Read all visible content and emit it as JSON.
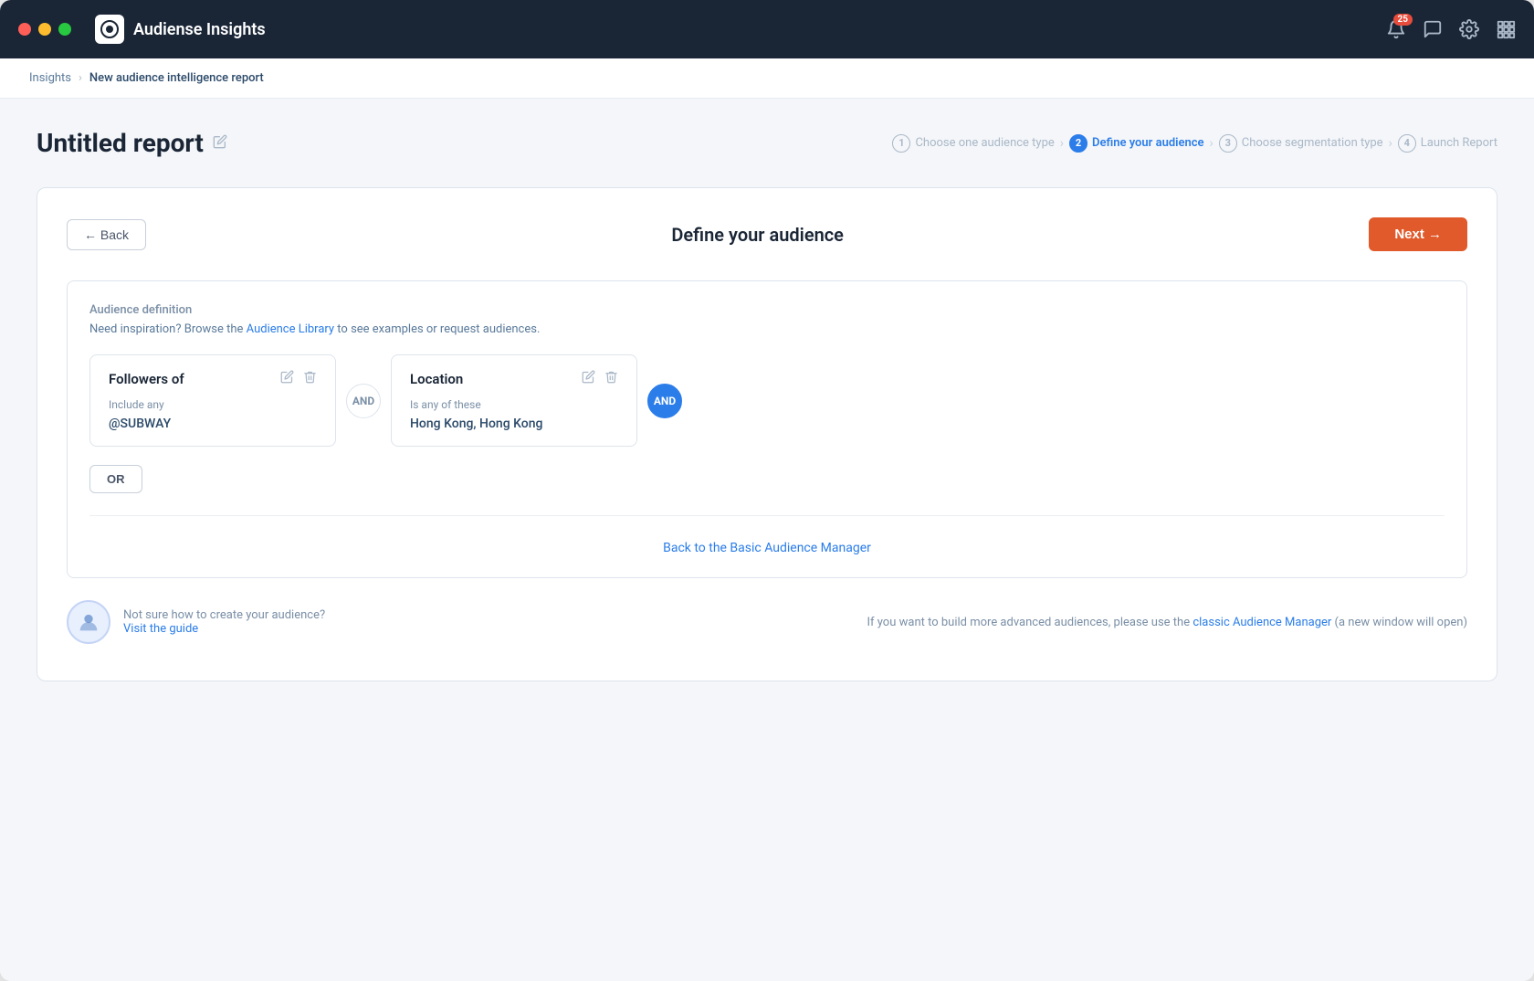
{
  "window": {
    "app_name": "Audiense Insights"
  },
  "breadcrumb": {
    "root": "Insights",
    "current": "New audience intelligence report"
  },
  "report": {
    "title": "Untitled report"
  },
  "steps": [
    {
      "num": "1",
      "label": "Choose one audience type",
      "state": "done"
    },
    {
      "num": "2",
      "label": "Define your audience",
      "state": "active"
    },
    {
      "num": "3",
      "label": "Choose segmentation type",
      "state": "upcoming"
    },
    {
      "num": "4",
      "label": "Launch Report",
      "state": "upcoming"
    }
  ],
  "toolbar": {
    "back_label": "← Back",
    "next_label": "Next →",
    "page_heading": "Define your audience"
  },
  "audience_def": {
    "label": "Audience definition",
    "description_pre": "Need inspiration? Browse the ",
    "link_text": "Audience Library",
    "description_post": " to see examples or request audiences."
  },
  "conditions": [
    {
      "id": "followers_of",
      "title": "Followers of",
      "tag": "Include any",
      "value": "@SUBWAY",
      "connector": "AND",
      "connector_type": "plain"
    },
    {
      "id": "location",
      "title": "Location",
      "tag": "Is any of these",
      "value": "Hong Kong, Hong Kong",
      "connector": "AND",
      "connector_type": "blue"
    }
  ],
  "or_button": "OR",
  "footer_link": "Back to the Basic Audience Manager",
  "help": {
    "text_pre": "Not sure how to create your audience?",
    "link_text": "Visit the guide"
  },
  "advanced": {
    "text_pre": "If you want to build more advanced audiences, please use the ",
    "link_text": "classic Audience Manager",
    "text_post": " (a new window will open)"
  },
  "nav": {
    "notification_count": "25"
  },
  "icons": {
    "bell": "🔔",
    "chat": "💬",
    "gear": "⚙️",
    "grid": "⋮⋮⋮",
    "edit": "✏️",
    "trash": "🗑",
    "pencil": "✏️"
  }
}
